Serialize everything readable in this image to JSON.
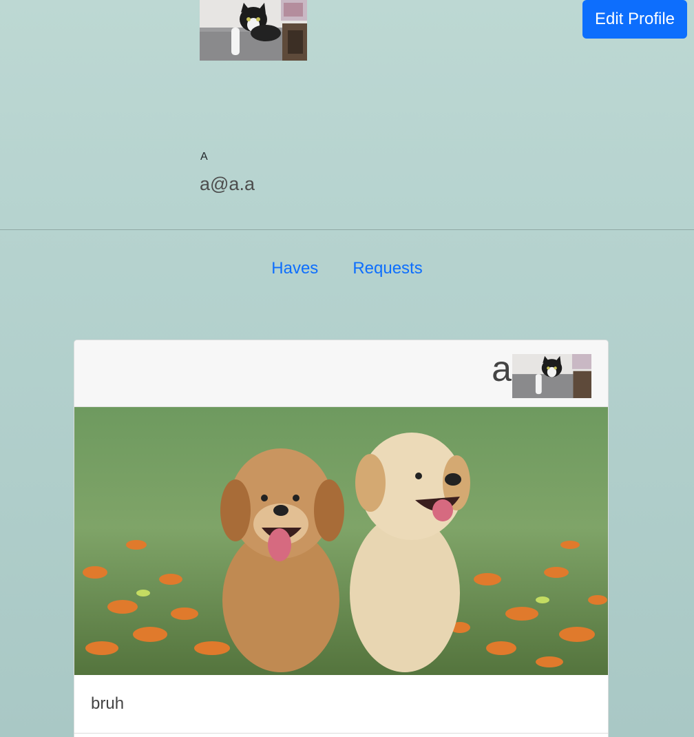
{
  "header": {
    "edit_profile_label": "Edit Profile"
  },
  "profile": {
    "photo_icon": "cat-on-couch-photo",
    "name": "A",
    "email": "a@a.a"
  },
  "tabs": [
    {
      "label": "Haves"
    },
    {
      "label": "Requests"
    }
  ],
  "card": {
    "owner_name": "a",
    "owner_avatar_icon": "cat-on-couch-photo",
    "image_icon": "two-puppies-in-flowers-photo",
    "text": "bruh"
  },
  "colors": {
    "primary": "#0d6efd",
    "background": "#b6d3cf"
  }
}
